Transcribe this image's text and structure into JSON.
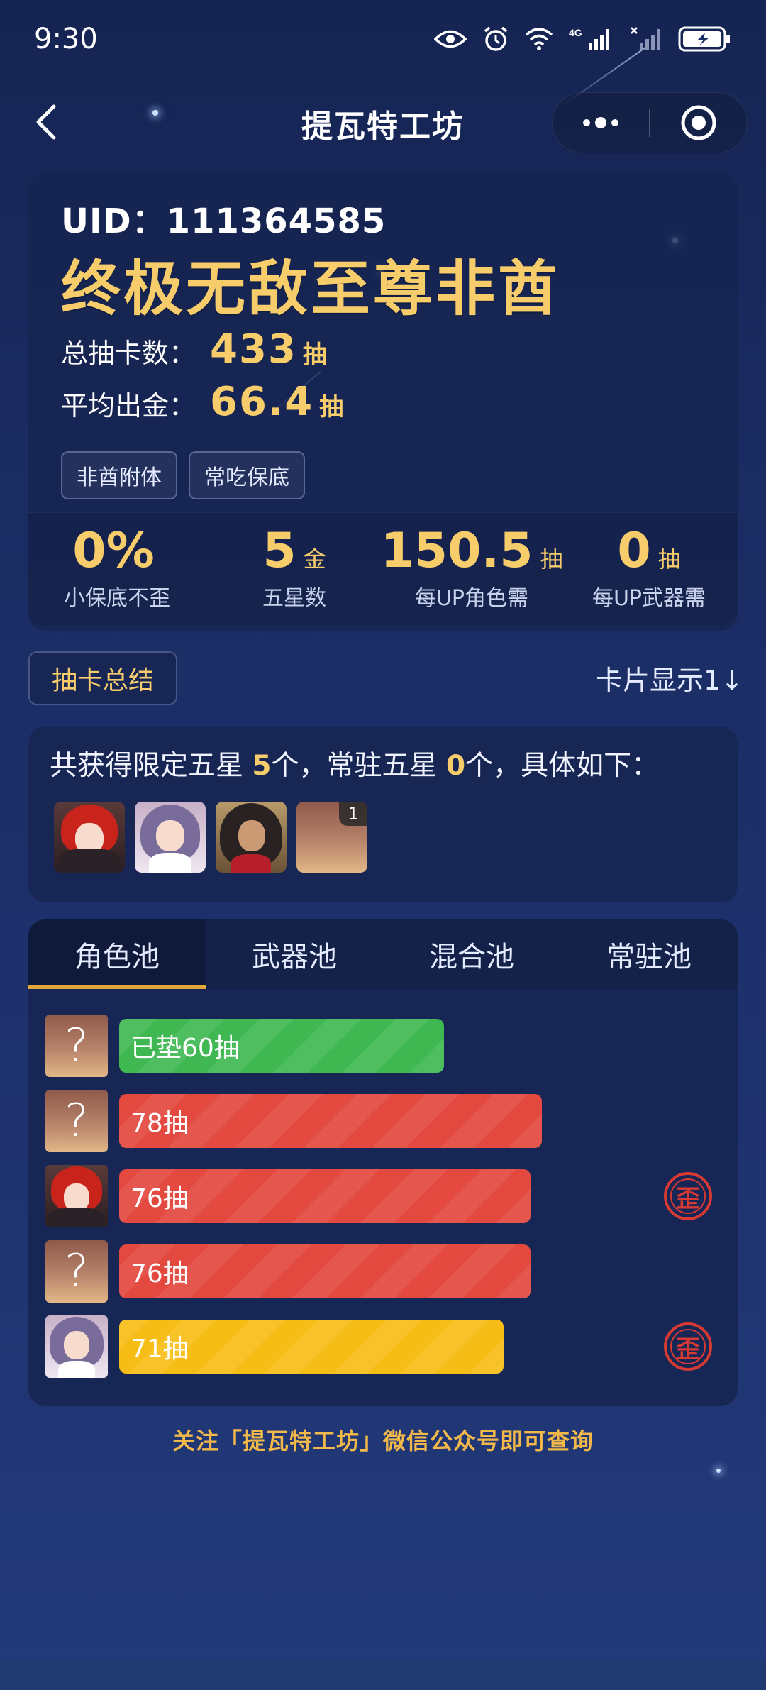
{
  "status_bar": {
    "time": "9:30",
    "network": "4G"
  },
  "nav": {
    "title": "提瓦特工坊"
  },
  "profile": {
    "uid": "UID：111364585",
    "nickname": "终极无敌至尊非酋",
    "total_pulls_label": "总抽卡数：",
    "total_pulls_value": "433",
    "total_pulls_unit": "抽",
    "avg_gold_label": "平均出金：",
    "avg_gold_value": "66.4",
    "avg_gold_unit": "抽",
    "tags": [
      "非酋附体",
      "常吃保底"
    ],
    "metrics": [
      {
        "value": "0%",
        "unit": "",
        "label": "小保底不歪"
      },
      {
        "value": "5",
        "unit": "金",
        "label": "五星数"
      },
      {
        "value": "150.5",
        "unit": "抽",
        "label": "每UP角色需"
      },
      {
        "value": "0",
        "unit": "抽",
        "label": "每UP武器需"
      }
    ]
  },
  "summary": {
    "button_label": "抽卡总结",
    "card_display_label": "卡片显示1↓"
  },
  "five_star": {
    "text_prefix": "共获得限定五星 ",
    "limited_count": "5",
    "text_mid": "个，常驻五星 ",
    "standard_count": "0",
    "text_suffix": "个，具体如下：",
    "avatars": [
      {
        "name": "diluc-avatar",
        "badge": ""
      },
      {
        "name": "keqing-avatar",
        "badge": ""
      },
      {
        "name": "dehya-avatar",
        "badge": ""
      },
      {
        "name": "unknown-avatar",
        "badge": "1"
      }
    ]
  },
  "pools": {
    "tabs": [
      "角色池",
      "武器池",
      "混合池",
      "常驻池"
    ],
    "active_tab": 0,
    "rows": [
      {
        "label": "已垫60抽",
        "pulls": 60,
        "color": "green",
        "avatar": "unknown",
        "lost_5050": false,
        "wai_label": ""
      },
      {
        "label": "78抽",
        "pulls": 78,
        "color": "red",
        "avatar": "unknown",
        "lost_5050": false,
        "wai_label": ""
      },
      {
        "label": "76抽",
        "pulls": 76,
        "color": "red",
        "avatar": "diluc",
        "lost_5050": true,
        "wai_label": "歪"
      },
      {
        "label": "76抽",
        "pulls": 76,
        "color": "red",
        "avatar": "unknown",
        "lost_5050": false,
        "wai_label": ""
      },
      {
        "label": "71抽",
        "pulls": 71,
        "color": "yellow",
        "avatar": "keqing",
        "lost_5050": true,
        "wai_label": "歪"
      }
    ]
  },
  "footer": {
    "note": "关注「提瓦特工坊」微信公众号即可查询"
  },
  "colors": {
    "gold": "#f7cc6b",
    "green": "#3fb852",
    "red": "#e3493f",
    "yellow": "#f7bd17",
    "tab_underline": "#e2a93a",
    "footer": "#f2b94a"
  }
}
